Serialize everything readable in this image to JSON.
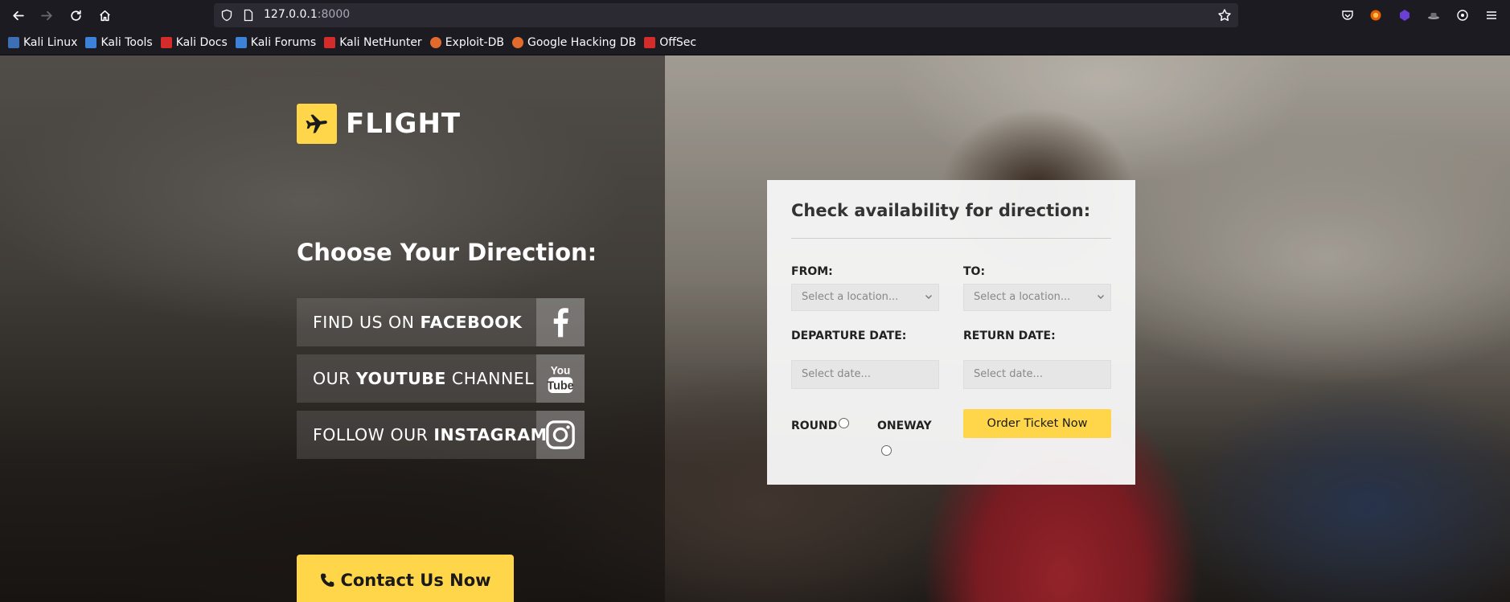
{
  "browser": {
    "url_host": "127.0.0.1",
    "url_port": ":8000",
    "bookmarks": [
      {
        "label": "Kali Linux",
        "color": "#3d6fb5"
      },
      {
        "label": "Kali Tools",
        "color": "#3b82d8"
      },
      {
        "label": "Kali Docs",
        "color": "#d42b2b"
      },
      {
        "label": "Kali Forums",
        "color": "#3b82d8"
      },
      {
        "label": "Kali NetHunter",
        "color": "#d42b2b"
      },
      {
        "label": "Exploit-DB",
        "color": "#e26a2c"
      },
      {
        "label": "Google Hacking DB",
        "color": "#e26a2c"
      },
      {
        "label": "OffSec",
        "color": "#d42b2b"
      }
    ]
  },
  "site": {
    "logo_text": "FLIGHT",
    "headline": "Choose Your Direction:",
    "social": [
      {
        "prefix": "FIND US ON ",
        "strong": "FACEBOOK",
        "suffix": "",
        "icon": "facebook-icon"
      },
      {
        "prefix": "OUR ",
        "strong": "YOUTUBE",
        "suffix": " CHANNEL",
        "icon": "youtube-icon"
      },
      {
        "prefix": "FOLLOW OUR ",
        "strong": "INSTAGRAM",
        "suffix": "",
        "icon": "instagram-icon"
      }
    ],
    "contact_label": "Contact Us Now",
    "accent": "#ffd64a"
  },
  "form": {
    "title": "Check availability for direction:",
    "from_label": "FROM:",
    "to_label": "TO:",
    "from_placeholder": "Select a location...",
    "to_placeholder": "Select a location...",
    "departure_label": "DEPARTURE DATE:",
    "return_label": "RETURN DATE:",
    "departure_placeholder": "Select date...",
    "return_placeholder": "Select date...",
    "round_label": "ROUND",
    "oneway_label": "ONEWAY",
    "order_label": "Order Ticket Now"
  }
}
